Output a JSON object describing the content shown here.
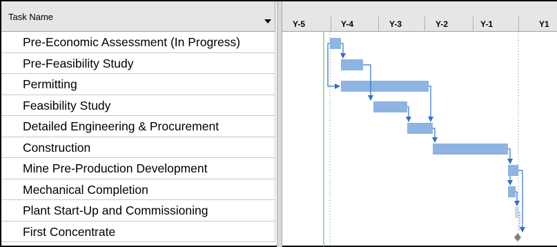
{
  "grid": {
    "header_title": "Task Name",
    "tasks": [
      "Pre-Economic Assessment (In Progress)",
      "Pre-Feasibility Study",
      "Permitting",
      "Feasibility Study",
      "Detailed Engineering & Procurement",
      "Construction",
      "Mine Pre-Production Development",
      "Mechanical Completion",
      "Plant Start-Up and Commissioning",
      "First Concentrate"
    ]
  },
  "timescale": {
    "labels": [
      "Y-5",
      "Y-4",
      "Y-3",
      "Y-2",
      "Y-1",
      "Y1"
    ]
  },
  "colors": {
    "bar": "#8db4e2",
    "link": "#2e6fcf",
    "header_bg": "#e6e6e6",
    "gridline": "#c8c8c8",
    "today_line": "#4caf50"
  }
}
